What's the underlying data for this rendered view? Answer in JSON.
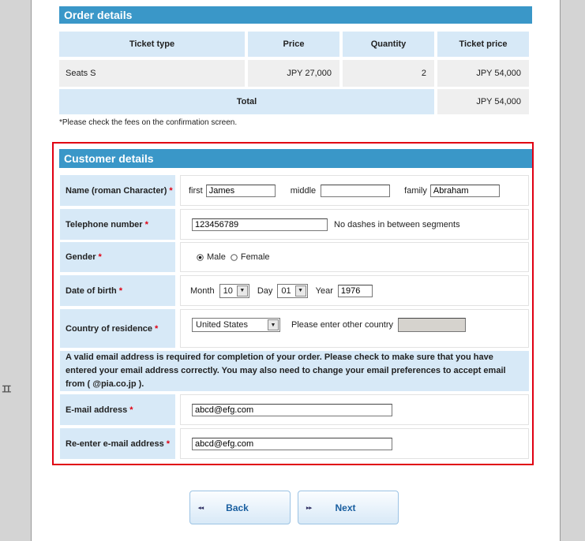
{
  "order": {
    "title": "Order details",
    "headers": [
      "Ticket type",
      "Price",
      "Quantity",
      "Ticket price"
    ],
    "row": {
      "type": "Seats S",
      "price": "JPY 27,000",
      "quantity": "2",
      "ticket_price": "JPY 54,000"
    },
    "total_label": "Total",
    "total_value": "JPY 54,000",
    "note": "*Please check the fees on the confirmation screen."
  },
  "customer": {
    "title": "Customer details",
    "required_mark": "*",
    "name": {
      "label": "Name (roman Character)",
      "first_label": "first",
      "first_value": "James",
      "middle_label": "middle",
      "middle_value": "",
      "family_label": "family",
      "family_value": "Abraham"
    },
    "phone": {
      "label": "Telephone number",
      "value": "123456789",
      "hint": "No dashes in between segments"
    },
    "gender": {
      "label": "Gender",
      "male": "Male",
      "female": "Female",
      "selected": "Male"
    },
    "dob": {
      "label": "Date of birth",
      "month_label": "Month",
      "month": "10",
      "day_label": "Day",
      "day": "01",
      "year_label": "Year",
      "year": "1976"
    },
    "country": {
      "label": "Country of residence",
      "value": "United States",
      "other_label": "Please enter other country",
      "other_value": ""
    },
    "email_notice": "A valid email address is required for completion of your order. Please check to make sure that you have entered your email address correctly. You may also need to change your email preferences to accept email from ( @pia.co.jp ).",
    "email": {
      "label": "E-mail address",
      "value": "abcd@efg.com"
    },
    "email2": {
      "label": "Re-enter e-mail address",
      "value": "abcd@efg.com"
    }
  },
  "buttons": {
    "back": "Back",
    "next": "Next",
    "back_arrow": "◂◂",
    "next_arrow": "▸▸"
  },
  "side_glyph": "ㅍ"
}
